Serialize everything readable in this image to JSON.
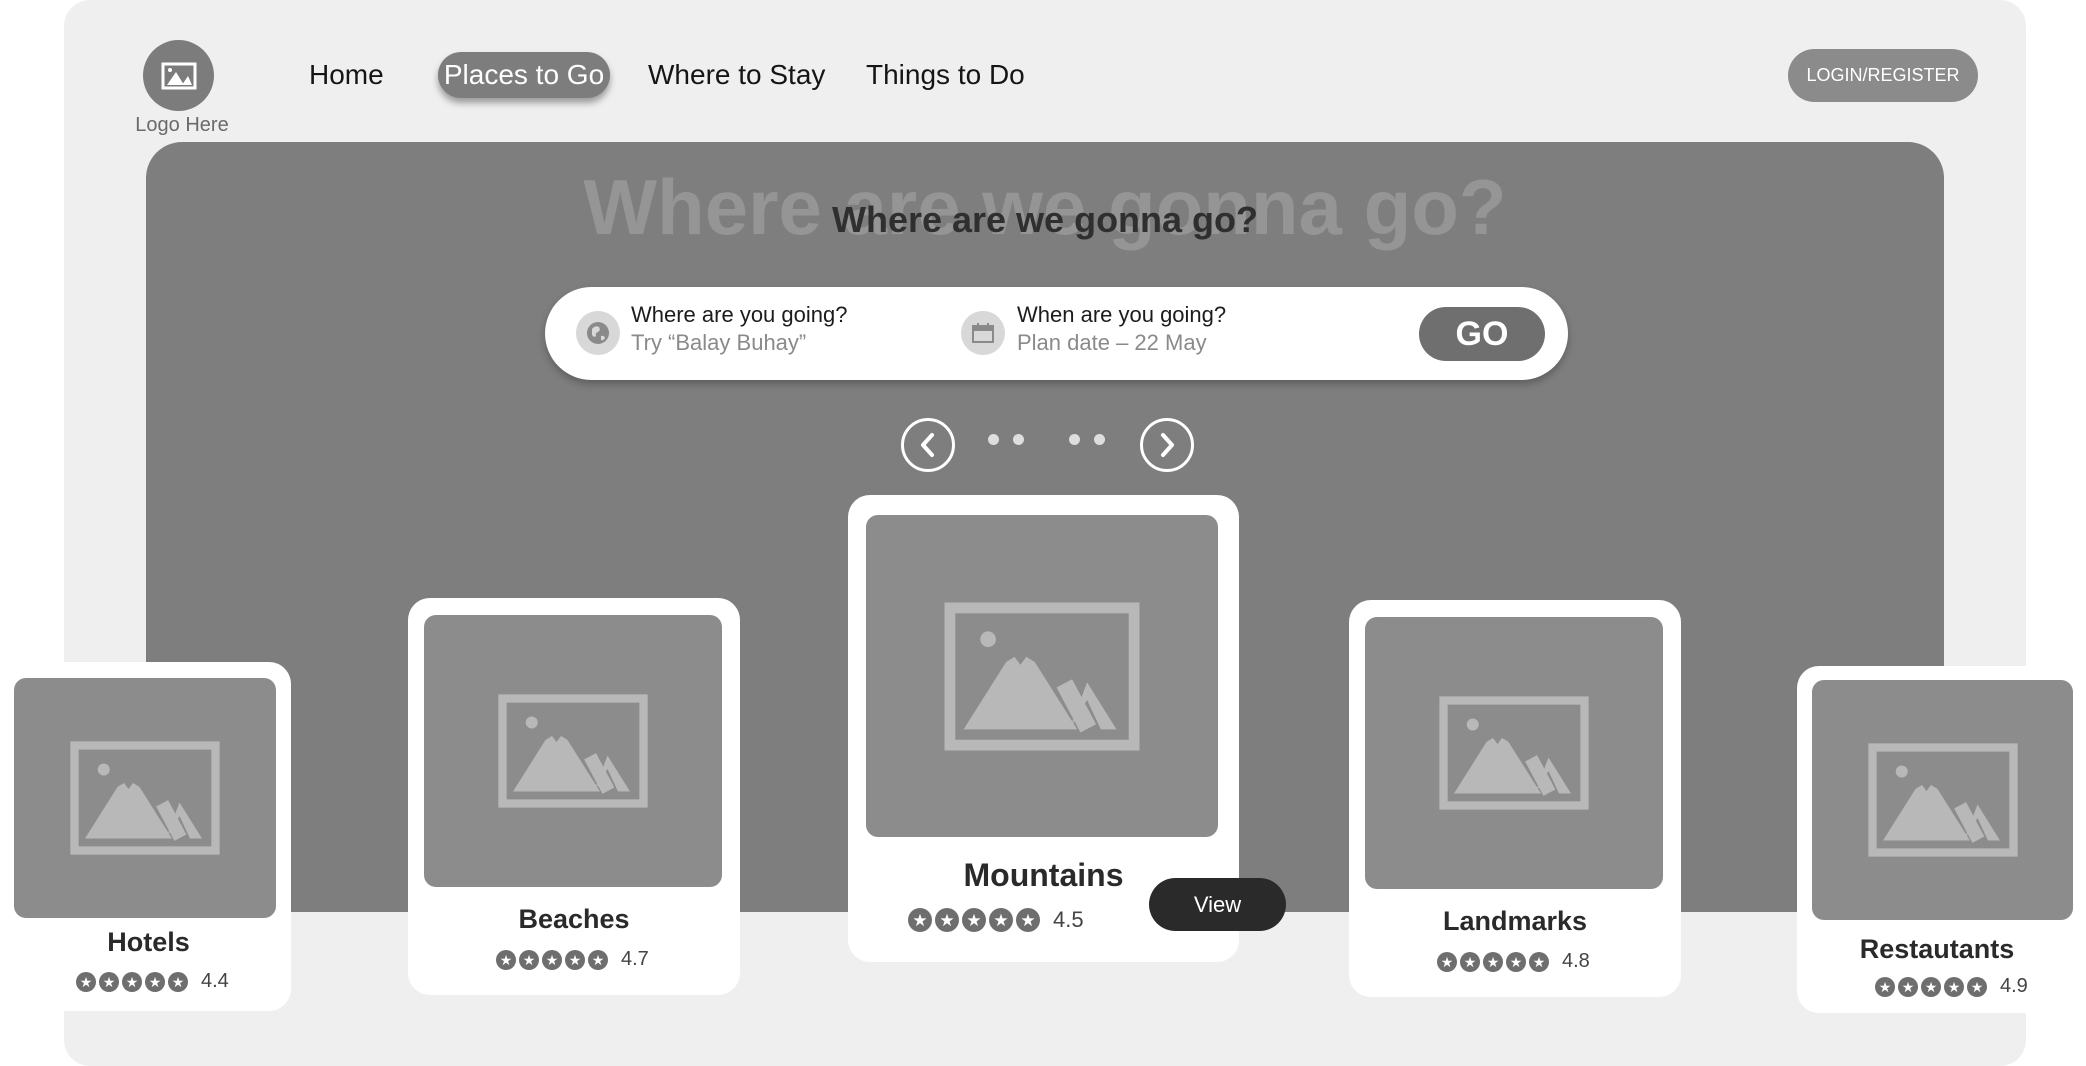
{
  "header": {
    "logo_text": "Logo Here",
    "nav": [
      "Home",
      "Places to Go",
      "Where to Stay",
      "Things to Do"
    ],
    "active_nav": "Places to Go",
    "login_label": "LOGIN/REGISTER"
  },
  "hero": {
    "ghost_title": "Where are we gonna go?",
    "title": "Where are we gonna go?"
  },
  "search": {
    "where_label": "Where are you going?",
    "where_placeholder": "Try “Balay Buhay”",
    "where_icon": "globe-icon",
    "when_label": "When are you going?",
    "when_placeholder": "Plan date – 22 May",
    "when_icon": "calendar-icon",
    "go_label": "GO"
  },
  "carousel": {
    "prev_icon": "chevron-left-icon",
    "next_icon": "chevron-right-icon",
    "view_label": "View",
    "cards": [
      {
        "name": "Hotels",
        "rating": "4.4"
      },
      {
        "name": "Beaches",
        "rating": "4.7"
      },
      {
        "name": "Mountains",
        "rating": "4.5"
      },
      {
        "name": "Landmarks",
        "rating": "4.8"
      },
      {
        "name": "Restautants",
        "rating": "4.9"
      }
    ]
  },
  "colors": {
    "page_bg": "#efefef",
    "hero_bg": "#7e7e7e",
    "active_nav_bg": "#7d7d7d",
    "view_button_bg": "#2a2a2a"
  }
}
